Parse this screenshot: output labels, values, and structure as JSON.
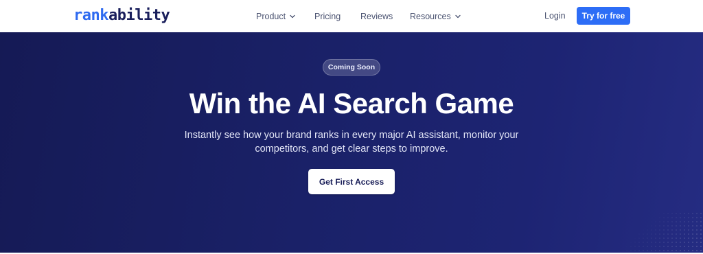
{
  "header": {
    "logo": {
      "part1": "rank",
      "part2": "ability"
    },
    "nav": {
      "product": "Product",
      "pricing": "Pricing",
      "reviews": "Reviews",
      "resources": "Resources"
    },
    "login": "Login",
    "cta": "Try for free",
    "icons": {
      "dropdown": "chevron-down-icon"
    }
  },
  "hero": {
    "badge": "Coming Soon",
    "title": "Win the AI Search Game",
    "subtitle": "Instantly see how your brand ranks in every major AI assistant, monitor your competitors, and get clear steps to improve.",
    "cta": "Get First Access"
  },
  "colors": {
    "brand_blue": "#2d6df6",
    "logo_dark": "#1a1f5c",
    "hero_bg": "#1a2168",
    "nav_text": "#4a5270"
  }
}
